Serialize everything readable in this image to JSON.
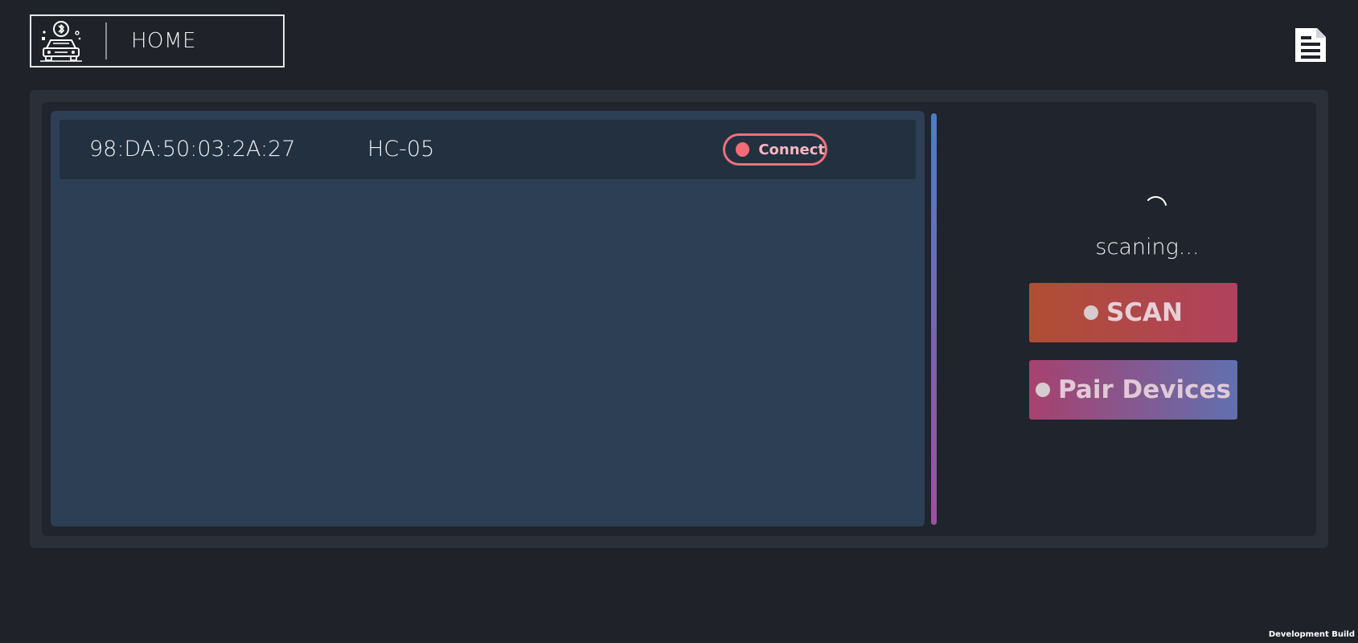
{
  "header": {
    "title": "HOME",
    "logo_icon": "car-bluetooth-logo-icon",
    "doc_icon": "document-icon"
  },
  "devices": [
    {
      "mac": "98:DA:50:03:2A:27",
      "name": "HC-05",
      "connect_label": "Connect"
    }
  ],
  "side_panel": {
    "status_text": "scaning...",
    "scan_label": "SCAN",
    "pair_label": "Pair Devices"
  },
  "footer": {
    "build_label": "Development Build"
  },
  "colors": {
    "background": "#1f2229",
    "list_background": "#2c3f54",
    "row_background": "#233040",
    "connect_accent": "#f56a78"
  }
}
